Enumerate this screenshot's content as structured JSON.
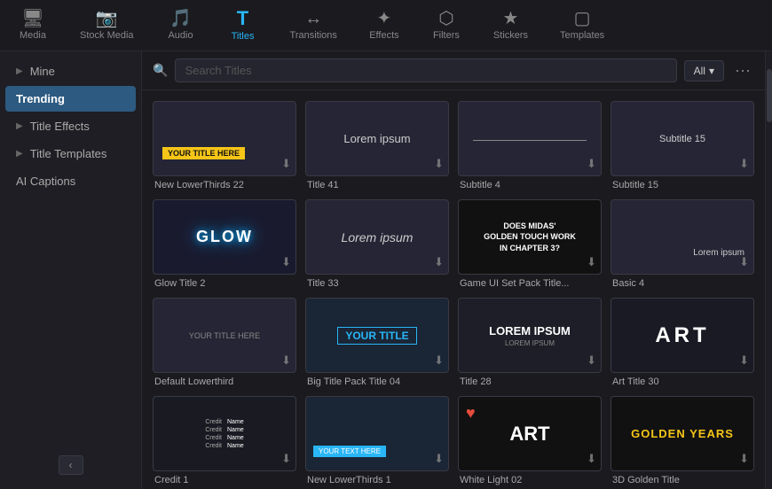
{
  "toolbar": {
    "items": [
      {
        "id": "media",
        "label": "Media",
        "icon": "🖥"
      },
      {
        "id": "stock-media",
        "label": "Stock Media",
        "icon": "📷"
      },
      {
        "id": "audio",
        "label": "Audio",
        "icon": "♪"
      },
      {
        "id": "titles",
        "label": "Titles",
        "icon": "T",
        "active": true
      },
      {
        "id": "transitions",
        "label": "Transitions",
        "icon": "↔"
      },
      {
        "id": "effects",
        "label": "Effects",
        "icon": "✦"
      },
      {
        "id": "filters",
        "label": "Filters",
        "icon": "⬡"
      },
      {
        "id": "stickers",
        "label": "Stickers",
        "icon": "★"
      },
      {
        "id": "templates",
        "label": "Templates",
        "icon": "▢"
      }
    ]
  },
  "sidebar": {
    "items": [
      {
        "id": "mine",
        "label": "Mine",
        "hasChevron": true
      },
      {
        "id": "trending",
        "label": "Trending",
        "active": true
      },
      {
        "id": "title-effects",
        "label": "Title Effects",
        "hasChevron": true
      },
      {
        "id": "title-templates",
        "label": "Title Templates",
        "hasChevron": true
      },
      {
        "id": "ai-captions",
        "label": "AI Captions"
      }
    ]
  },
  "search": {
    "placeholder": "Search Titles",
    "filter_label": "All",
    "more_icon": "···"
  },
  "grid": {
    "items": [
      {
        "id": 1,
        "label": "New LowerThirds 22",
        "thumb_type": "yellow-bar"
      },
      {
        "id": 2,
        "label": "Title 41",
        "thumb_type": "lorem-center"
      },
      {
        "id": 3,
        "label": "Subtitle 4",
        "thumb_type": "subtitle-line"
      },
      {
        "id": 4,
        "label": "Subtitle 15",
        "thumb_type": "subtitle15"
      },
      {
        "id": 5,
        "label": "Glow Title 2",
        "thumb_type": "glow"
      },
      {
        "id": 6,
        "label": "Title 33",
        "thumb_type": "lorem-italic"
      },
      {
        "id": 7,
        "label": "Game UI Set Pack Title...",
        "thumb_type": "game-ui"
      },
      {
        "id": 8,
        "label": "Basic 4",
        "thumb_type": "lorem-bottom"
      },
      {
        "id": 9,
        "label": "Default Lowerthird",
        "thumb_type": "default-lower"
      },
      {
        "id": 10,
        "label": "Big Title Pack Title 04",
        "thumb_type": "your-title"
      },
      {
        "id": 11,
        "label": "Title 28",
        "thumb_type": "lorem-ipsum-block"
      },
      {
        "id": 12,
        "label": "Art Title 30",
        "thumb_type": "art"
      },
      {
        "id": 13,
        "label": "Credit 1",
        "thumb_type": "credit"
      },
      {
        "id": 14,
        "label": "New LowerThirds 1",
        "thumb_type": "new-lower"
      },
      {
        "id": 15,
        "label": "White Light 02",
        "thumb_type": "white-art"
      },
      {
        "id": 16,
        "label": "3D Golden Title",
        "thumb_type": "golden"
      }
    ]
  }
}
